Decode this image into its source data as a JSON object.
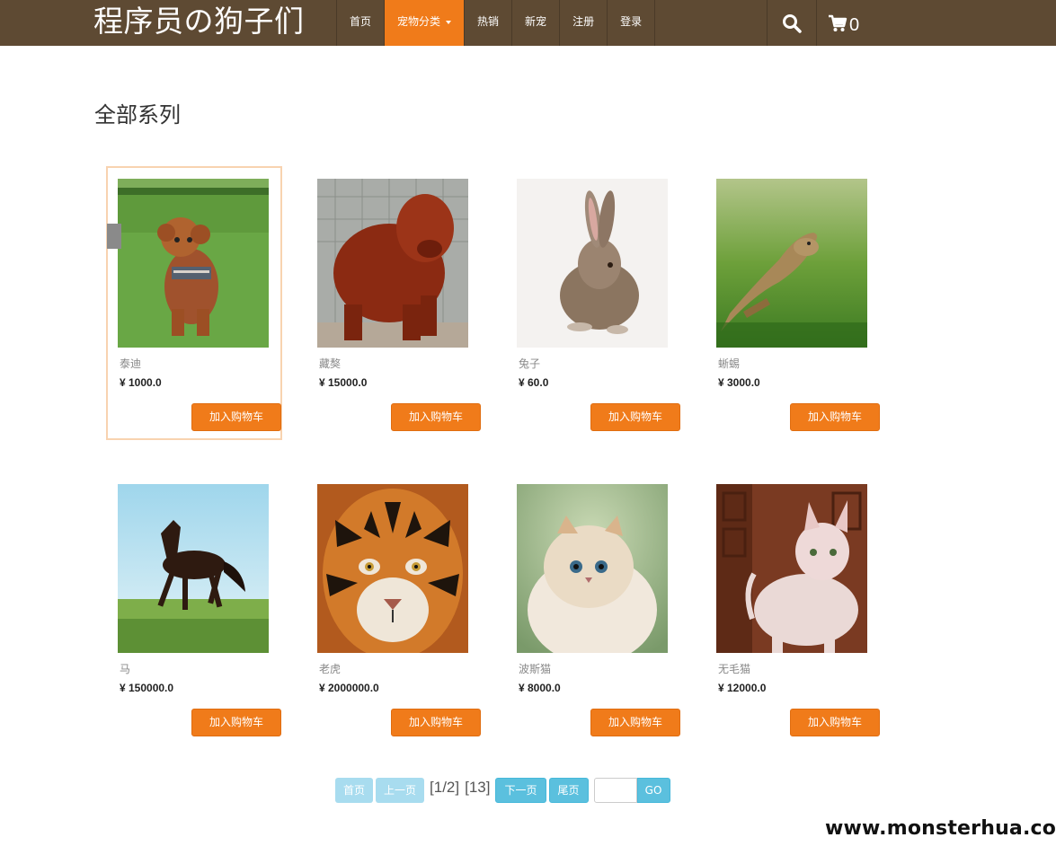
{
  "brand": "程序员の狗子们",
  "nav": {
    "items": [
      {
        "label": "首页"
      },
      {
        "label": "宠物分类"
      },
      {
        "label": "热销"
      },
      {
        "label": "新宠"
      },
      {
        "label": "注册"
      },
      {
        "label": "登录"
      }
    ],
    "cart_count": "0"
  },
  "section_title": "全部系列",
  "products": [
    {
      "name": "泰迪",
      "price": "¥ 1000.0",
      "button": "加入购物车"
    },
    {
      "name": "藏獒",
      "price": "¥ 15000.0",
      "button": "加入购物车"
    },
    {
      "name": "兔子",
      "price": "¥ 60.0",
      "button": "加入购物车"
    },
    {
      "name": "蜥蜴",
      "price": "¥ 3000.0",
      "button": "加入购物车"
    },
    {
      "name": "马",
      "price": "¥ 150000.0",
      "button": "加入购物车"
    },
    {
      "name": "老虎",
      "price": "¥ 2000000.0",
      "button": "加入购物车"
    },
    {
      "name": "波斯猫",
      "price": "¥ 8000.0",
      "button": "加入购物车"
    },
    {
      "name": "无毛猫",
      "price": "¥ 12000.0",
      "button": "加入购物车"
    }
  ],
  "pagination": {
    "first": "首页",
    "prev": "上一页",
    "page_info": "[1/2]",
    "total": "[13]",
    "next": "下一页",
    "last": "尾页",
    "go": "GO",
    "input_value": ""
  },
  "watermark": "www.monsterhua.com",
  "colors": {
    "navbar": "#5e4a33",
    "accent": "#f07b1a",
    "pager_enabled": "#5bc0de",
    "pager_disabled": "#a8dcef"
  }
}
